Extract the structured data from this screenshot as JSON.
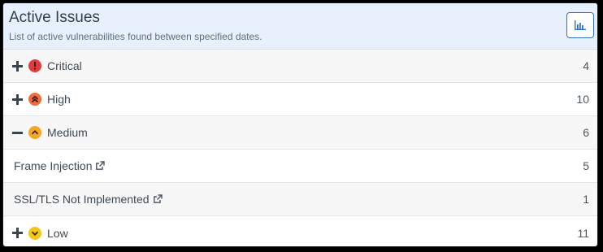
{
  "header": {
    "title": "Active Issues",
    "subtitle": "List of active vulnerabilities found between specified dates."
  },
  "colors": {
    "critical": "#e23b3b",
    "high": "#f26b3a",
    "medium": "#f5a623",
    "low": "#f5c518",
    "accent": "#2e6fd1"
  },
  "rows": [
    {
      "type": "severity",
      "label": "Critical",
      "count": "4",
      "expanded": false,
      "icon": "exclamation-icon"
    },
    {
      "type": "severity",
      "label": "High",
      "count": "10",
      "expanded": false,
      "icon": "double-chevron-up-icon"
    },
    {
      "type": "severity",
      "label": "Medium",
      "count": "6",
      "expanded": true,
      "icon": "chevron-up-icon"
    },
    {
      "type": "issue",
      "label": "Frame Injection",
      "count": "5"
    },
    {
      "type": "issue",
      "label": "SSL/TLS Not Implemented",
      "count": "1"
    },
    {
      "type": "severity",
      "label": "Low",
      "count": "11",
      "expanded": false,
      "icon": "chevron-down-icon"
    }
  ]
}
